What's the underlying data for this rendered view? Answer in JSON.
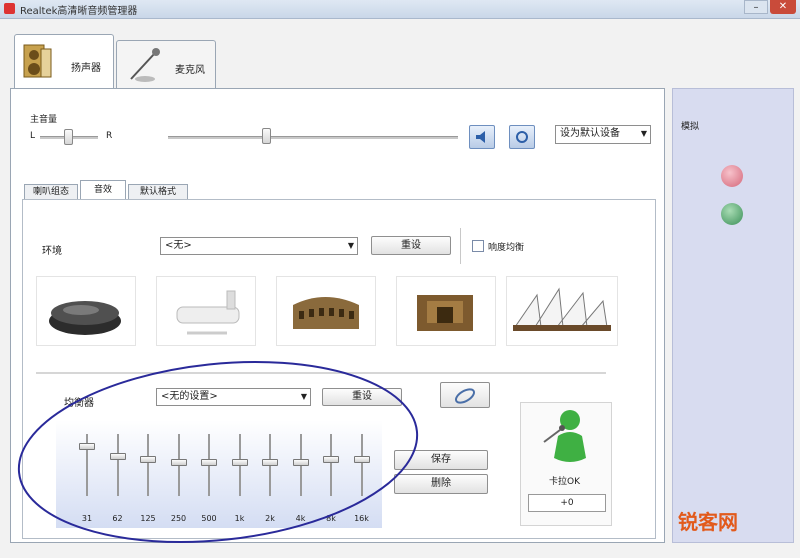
{
  "window": {
    "title": "Realtek高清晰音频管理器",
    "close_label": "✕",
    "minimize_label": "–"
  },
  "tabs": [
    {
      "label": "扬声器",
      "icon": "speaker-box-icon",
      "selected": true
    },
    {
      "label": "麦克风",
      "icon": "microphone-icon",
      "selected": false
    }
  ],
  "volume": {
    "label": "主音量",
    "left_label": "L",
    "right_label": "R",
    "set_default": "设为默认设备"
  },
  "subtabs": [
    "喇叭组态",
    "音效",
    "默认格式"
  ],
  "effects": {
    "env_label": "环境",
    "env_value": "<无>",
    "reset_label": "重设",
    "loudness_label": "响度均衡",
    "environments": [
      "stone-icon",
      "bathtub-icon",
      "colosseum-icon",
      "ruins-icon",
      "opera-house-icon"
    ]
  },
  "equalizer": {
    "label": "均衡器",
    "preset_value": "<无的设置>",
    "reset_label": "重设",
    "bands": [
      "31",
      "62",
      "125",
      "250",
      "500",
      "1k",
      "2k",
      "4k",
      "8k",
      "16k"
    ],
    "levels": [
      0.2,
      0.35,
      0.4,
      0.45,
      0.45,
      0.45,
      0.45,
      0.45,
      0.4,
      0.4
    ],
    "save_label": "保存",
    "delete_label": "删除",
    "karaoke_label": "卡拉OK",
    "karaoke_value": "+0"
  },
  "right_panel": {
    "title": "模拟",
    "jack_colors": [
      "#e87a8c",
      "#4ea86a"
    ]
  },
  "watermark": "锐客网"
}
